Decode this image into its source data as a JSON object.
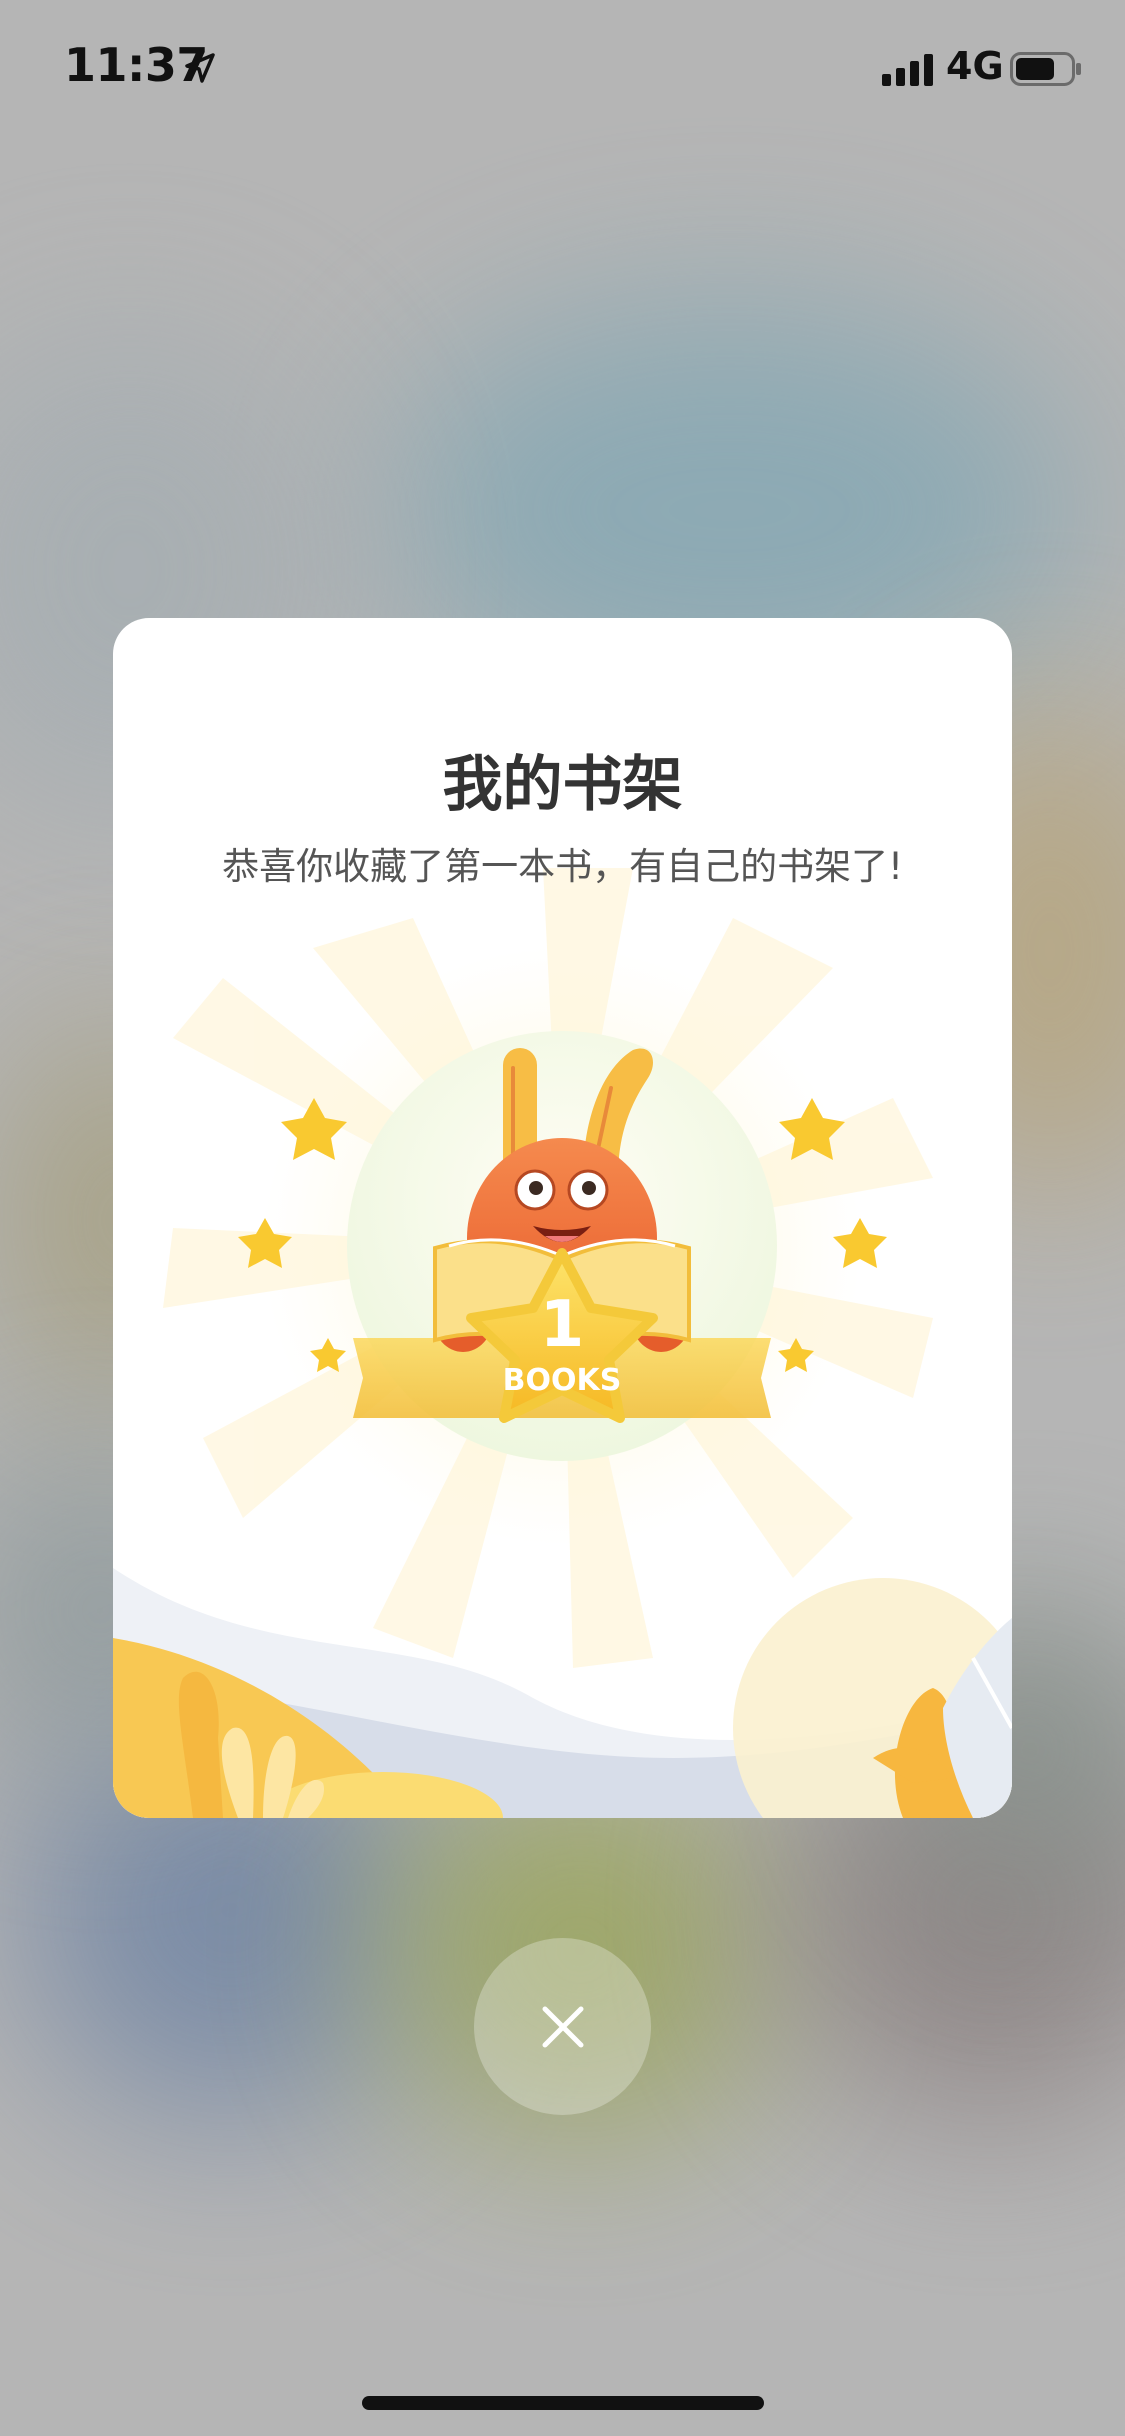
{
  "status_bar": {
    "time": "11:37",
    "network": "4G",
    "icons": [
      "location-arrow-icon",
      "signal-icon",
      "battery-icon"
    ]
  },
  "dialog": {
    "title": "我的书架",
    "subtitle": "恭喜你收藏了第一本书，有自己的书架了!",
    "badge_number": "1",
    "badge_label": "BOOKS"
  },
  "close_button": {
    "icon": "close-icon"
  },
  "colors": {
    "star": "#f9c930",
    "mascot": "#f06a35",
    "card": "#ffffff"
  }
}
